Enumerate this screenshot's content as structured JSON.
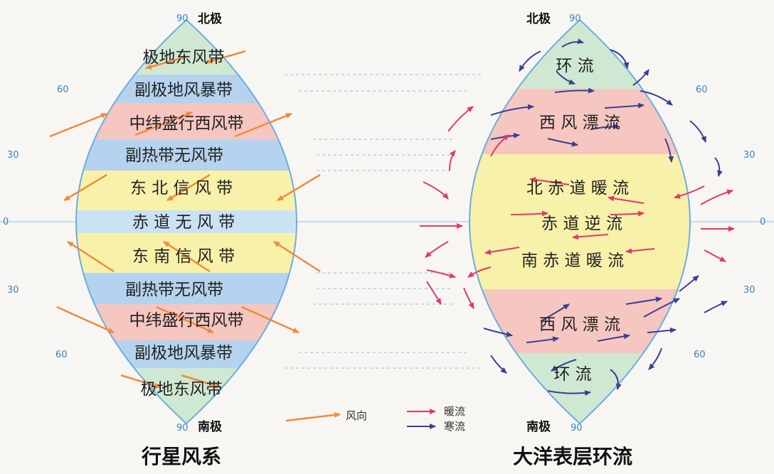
{
  "colors": {
    "polar": "#cfe8d2",
    "subpolar": "#b5d3ee",
    "westerlies": "#f6c6c0",
    "subtropical": "#b5d3ee",
    "trades": "#f8f1a9",
    "equator": "#c9e3f5",
    "outline": "#6aaee0",
    "wind_arrow": "#ef8b3a",
    "warm_current": "#e2386a",
    "cold_current": "#3a3f95",
    "latline": "#8ec2e8"
  },
  "left_diagram": {
    "north_pole": "北极",
    "south_pole": "南极",
    "belts": [
      "极地东风带",
      "副极地风暴带",
      "中纬盛行西风带",
      "副热带无风带",
      "东 北 信 风 带",
      "赤 道 无 风 带",
      "东 南 信 风 带",
      "副热带无风带",
      "中纬盛行西风带",
      "副极地风暴带",
      "极地东风带"
    ],
    "caption": "行星风系"
  },
  "right_diagram": {
    "north_pole": "北极",
    "south_pole": "南极",
    "labels": [
      "环 流",
      "西 风 漂 流",
      "北 赤 道 暖 流",
      "赤 道 逆 流",
      "南 赤 道 暖 流",
      "西 风 漂 流",
      "环 流"
    ],
    "caption": "大洋表层环流"
  },
  "latitudes": {
    "top_left": "90",
    "top_right": "90",
    "n60": "60",
    "n30": "30",
    "eq": "0",
    "s30": "30",
    "s60": "60",
    "bottom_left": "90",
    "bottom_right": "90"
  },
  "legend": {
    "wind": "风向",
    "warm": "暖流",
    "cold": "寒流"
  }
}
